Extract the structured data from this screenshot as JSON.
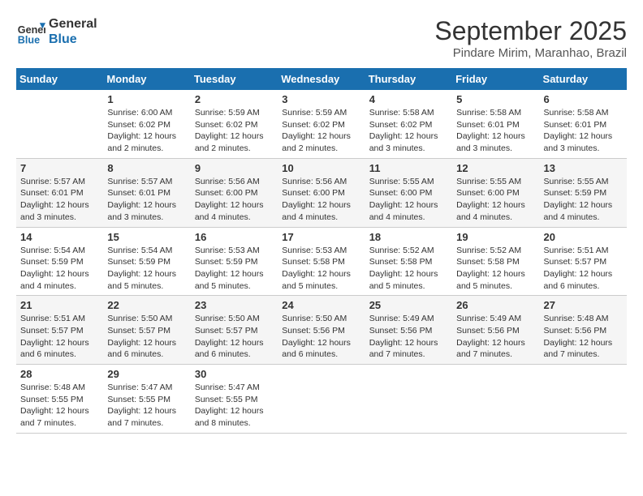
{
  "header": {
    "logo_line1": "General",
    "logo_line2": "Blue",
    "month": "September 2025",
    "location": "Pindare Mirim, Maranhao, Brazil"
  },
  "days_header": [
    "Sunday",
    "Monday",
    "Tuesday",
    "Wednesday",
    "Thursday",
    "Friday",
    "Saturday"
  ],
  "weeks": [
    [
      {
        "day": "",
        "info": ""
      },
      {
        "day": "1",
        "info": "Sunrise: 6:00 AM\nSunset: 6:02 PM\nDaylight: 12 hours\nand 2 minutes."
      },
      {
        "day": "2",
        "info": "Sunrise: 5:59 AM\nSunset: 6:02 PM\nDaylight: 12 hours\nand 2 minutes."
      },
      {
        "day": "3",
        "info": "Sunrise: 5:59 AM\nSunset: 6:02 PM\nDaylight: 12 hours\nand 2 minutes."
      },
      {
        "day": "4",
        "info": "Sunrise: 5:58 AM\nSunset: 6:02 PM\nDaylight: 12 hours\nand 3 minutes."
      },
      {
        "day": "5",
        "info": "Sunrise: 5:58 AM\nSunset: 6:01 PM\nDaylight: 12 hours\nand 3 minutes."
      },
      {
        "day": "6",
        "info": "Sunrise: 5:58 AM\nSunset: 6:01 PM\nDaylight: 12 hours\nand 3 minutes."
      }
    ],
    [
      {
        "day": "7",
        "info": "Sunrise: 5:57 AM\nSunset: 6:01 PM\nDaylight: 12 hours\nand 3 minutes."
      },
      {
        "day": "8",
        "info": "Sunrise: 5:57 AM\nSunset: 6:01 PM\nDaylight: 12 hours\nand 3 minutes."
      },
      {
        "day": "9",
        "info": "Sunrise: 5:56 AM\nSunset: 6:00 PM\nDaylight: 12 hours\nand 4 minutes."
      },
      {
        "day": "10",
        "info": "Sunrise: 5:56 AM\nSunset: 6:00 PM\nDaylight: 12 hours\nand 4 minutes."
      },
      {
        "day": "11",
        "info": "Sunrise: 5:55 AM\nSunset: 6:00 PM\nDaylight: 12 hours\nand 4 minutes."
      },
      {
        "day": "12",
        "info": "Sunrise: 5:55 AM\nSunset: 6:00 PM\nDaylight: 12 hours\nand 4 minutes."
      },
      {
        "day": "13",
        "info": "Sunrise: 5:55 AM\nSunset: 5:59 PM\nDaylight: 12 hours\nand 4 minutes."
      }
    ],
    [
      {
        "day": "14",
        "info": "Sunrise: 5:54 AM\nSunset: 5:59 PM\nDaylight: 12 hours\nand 4 minutes."
      },
      {
        "day": "15",
        "info": "Sunrise: 5:54 AM\nSunset: 5:59 PM\nDaylight: 12 hours\nand 5 minutes."
      },
      {
        "day": "16",
        "info": "Sunrise: 5:53 AM\nSunset: 5:59 PM\nDaylight: 12 hours\nand 5 minutes."
      },
      {
        "day": "17",
        "info": "Sunrise: 5:53 AM\nSunset: 5:58 PM\nDaylight: 12 hours\nand 5 minutes."
      },
      {
        "day": "18",
        "info": "Sunrise: 5:52 AM\nSunset: 5:58 PM\nDaylight: 12 hours\nand 5 minutes."
      },
      {
        "day": "19",
        "info": "Sunrise: 5:52 AM\nSunset: 5:58 PM\nDaylight: 12 hours\nand 5 minutes."
      },
      {
        "day": "20",
        "info": "Sunrise: 5:51 AM\nSunset: 5:57 PM\nDaylight: 12 hours\nand 6 minutes."
      }
    ],
    [
      {
        "day": "21",
        "info": "Sunrise: 5:51 AM\nSunset: 5:57 PM\nDaylight: 12 hours\nand 6 minutes."
      },
      {
        "day": "22",
        "info": "Sunrise: 5:50 AM\nSunset: 5:57 PM\nDaylight: 12 hours\nand 6 minutes."
      },
      {
        "day": "23",
        "info": "Sunrise: 5:50 AM\nSunset: 5:57 PM\nDaylight: 12 hours\nand 6 minutes."
      },
      {
        "day": "24",
        "info": "Sunrise: 5:50 AM\nSunset: 5:56 PM\nDaylight: 12 hours\nand 6 minutes."
      },
      {
        "day": "25",
        "info": "Sunrise: 5:49 AM\nSunset: 5:56 PM\nDaylight: 12 hours\nand 7 minutes."
      },
      {
        "day": "26",
        "info": "Sunrise: 5:49 AM\nSunset: 5:56 PM\nDaylight: 12 hours\nand 7 minutes."
      },
      {
        "day": "27",
        "info": "Sunrise: 5:48 AM\nSunset: 5:56 PM\nDaylight: 12 hours\nand 7 minutes."
      }
    ],
    [
      {
        "day": "28",
        "info": "Sunrise: 5:48 AM\nSunset: 5:55 PM\nDaylight: 12 hours\nand 7 minutes."
      },
      {
        "day": "29",
        "info": "Sunrise: 5:47 AM\nSunset: 5:55 PM\nDaylight: 12 hours\nand 7 minutes."
      },
      {
        "day": "30",
        "info": "Sunrise: 5:47 AM\nSunset: 5:55 PM\nDaylight: 12 hours\nand 8 minutes."
      },
      {
        "day": "",
        "info": ""
      },
      {
        "day": "",
        "info": ""
      },
      {
        "day": "",
        "info": ""
      },
      {
        "day": "",
        "info": ""
      }
    ]
  ]
}
